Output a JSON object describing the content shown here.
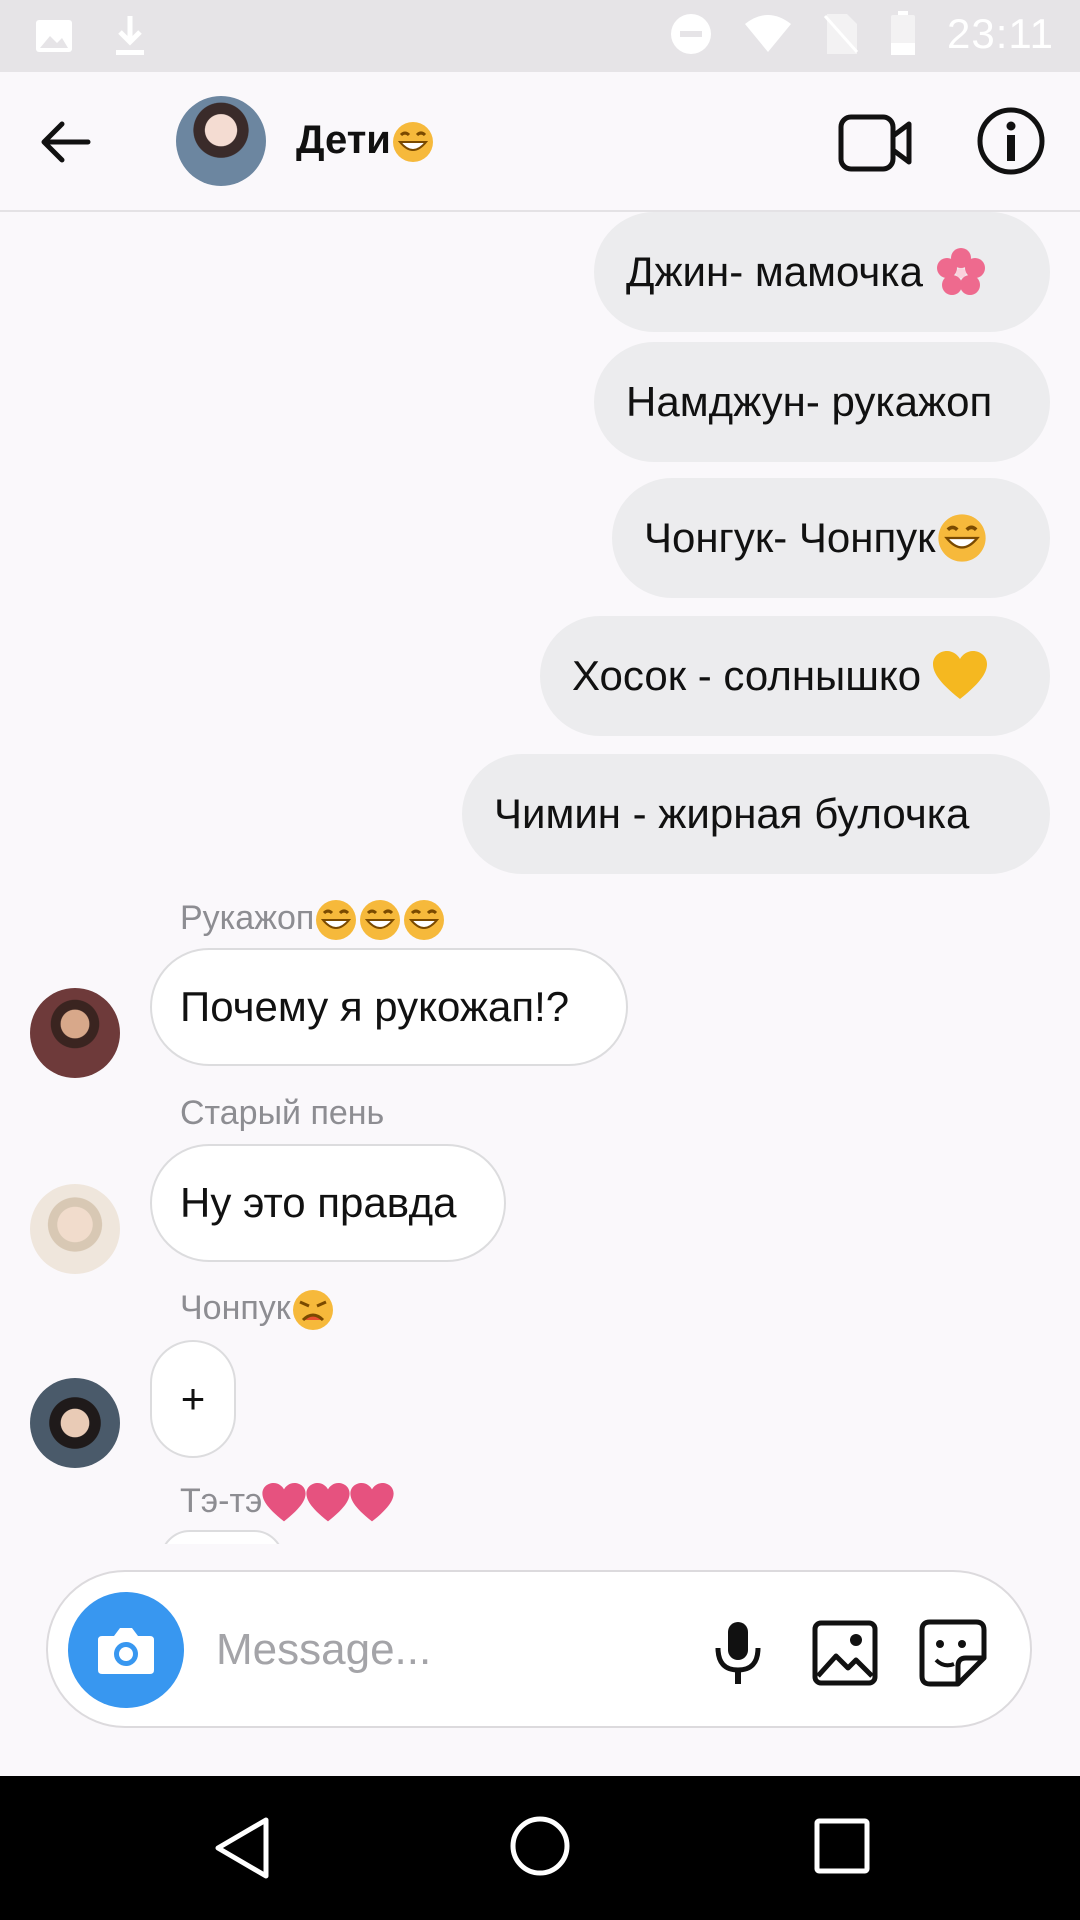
{
  "status_bar": {
    "time": "23:11"
  },
  "header": {
    "title": "Дети",
    "title_emoji_icon": "grinning-face-emoji"
  },
  "messages_outgoing": [
    {
      "text": "Джин- мамочка",
      "emoji_icon": "cherry-blossom-emoji"
    },
    {
      "text": "Намджун- рукажоп",
      "emoji_icon": ""
    },
    {
      "text": "Чонгук- Чонпук",
      "emoji_icon": "grinning-face-emoji"
    },
    {
      "text": "Хосок - солнышко",
      "emoji_icon": "yellow-heart-emoji"
    },
    {
      "text": "Чимин - жирная булочка",
      "emoji_icon": ""
    }
  ],
  "messages_incoming": [
    {
      "sender": "Рукажоп",
      "sender_emoji_icon": "grinning-face-emoji x3",
      "text": "Почему я рукожап!?"
    },
    {
      "sender": "Старый пень",
      "text": "Ну это правда"
    },
    {
      "sender": "Чонпук",
      "sender_emoji_icon": "crying-face-emoji",
      "text": "+"
    },
    {
      "sender": "Тэ-тэ",
      "sender_emoji_icon": "pink-heart-emoji x3"
    }
  ],
  "composer": {
    "placeholder": "Message..."
  },
  "colors": {
    "accent": "#3897f0",
    "bubble_out": "#ececee",
    "bubble_in_border": "#dcdcde"
  }
}
